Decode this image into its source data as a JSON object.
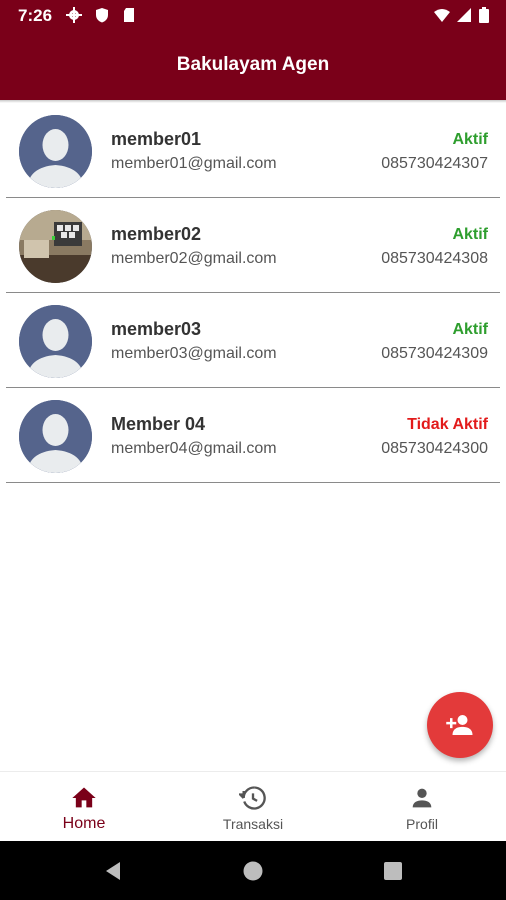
{
  "status_bar": {
    "time": "7:26"
  },
  "app_bar": {
    "title": "Bakulayam Agen"
  },
  "members": [
    {
      "name": "member01",
      "email": "member01@gmail.com",
      "status": "Aktif",
      "phone": "085730424307",
      "status_color": "#2e9e2e",
      "avatar": "placeholder"
    },
    {
      "name": "member02",
      "email": "member02@gmail.com",
      "status": "Aktif",
      "phone": "085730424308",
      "status_color": "#2e9e2e",
      "avatar": "photo"
    },
    {
      "name": "member03",
      "email": "member03@gmail.com",
      "status": "Aktif",
      "phone": "085730424309",
      "status_color": "#2e9e2e",
      "avatar": "placeholder"
    },
    {
      "name": "Member 04",
      "email": "member04@gmail.com",
      "status": "Tidak Aktif",
      "phone": "085730424300",
      "status_color": "#e21b1b",
      "avatar": "placeholder"
    }
  ],
  "fab": {
    "icon": "add-person-icon"
  },
  "bottom_nav": {
    "items": [
      {
        "label": "Home",
        "icon": "home-icon",
        "active": true
      },
      {
        "label": "Transaksi",
        "icon": "history-icon",
        "active": false
      },
      {
        "label": "Profil",
        "icon": "person-icon",
        "active": false
      }
    ]
  },
  "colors": {
    "primary": "#7a0019",
    "fab": "#e33a3a",
    "active_status": "#2e9e2e",
    "inactive_status": "#e21b1b"
  }
}
